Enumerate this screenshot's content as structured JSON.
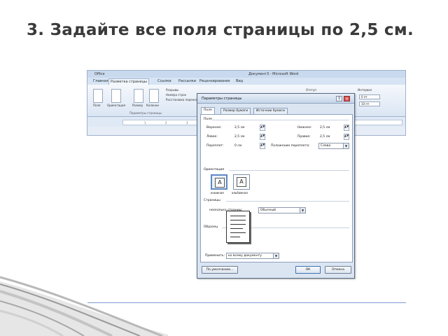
{
  "slide": {
    "title": "3. Задайте все поля страницы по 2,5 см."
  },
  "word": {
    "window_title": "Документ3 - Microsoft Word",
    "app_left_label": "Office",
    "tabs": [
      {
        "label": "Главная"
      },
      {
        "label": "Разметка страницы"
      },
      {
        "label": "Ссылки"
      },
      {
        "label": "Рассылки"
      },
      {
        "label": "Рецензирование"
      },
      {
        "label": "Вид"
      }
    ],
    "ribbon": {
      "buttons": [
        {
          "label": "Поля"
        },
        {
          "label": "Ориентация"
        },
        {
          "label": "Размер"
        },
        {
          "label": "Колонки"
        }
      ],
      "list_items": [
        "Разрывы",
        "Номера строк",
        "Расстановка переносов"
      ],
      "group_label": "Параметры страницы",
      "indent_label": "Отступ",
      "spacing_label": "Интервал",
      "spacing_fields": [
        "0 пт",
        "10 пт"
      ],
      "ruler_marks": [
        "1",
        "2",
        "3"
      ]
    }
  },
  "dialog": {
    "title": "Параметры страницы",
    "help_glyph": "?",
    "close_glyph": "×",
    "tabs": [
      {
        "label": "Поля"
      },
      {
        "label": "Размер бумаги"
      },
      {
        "label": "Источник бумаги"
      }
    ],
    "margins": {
      "section_label": "Поля",
      "top_label": "Верхнее:",
      "top_value": "2,5 см",
      "bottom_label": "Нижнее:",
      "bottom_value": "2,5 см",
      "left_label": "Левое:",
      "left_value": "2,5 см",
      "right_label": "Правое:",
      "right_value": "2,5 см",
      "gutter_label": "Переплет:",
      "gutter_value": "0 см",
      "gutter_pos_label": "Положение переплета:",
      "gutter_pos_value": "Слева"
    },
    "orientation": {
      "section_label": "Ориентация",
      "portrait_label": "книжная",
      "landscape_label": "альбомная",
      "glyph": "A"
    },
    "pages": {
      "section_label": "Страницы",
      "multiple_label": "несколько страниц:",
      "multiple_value": "Обычный"
    },
    "preview": {
      "section_label": "Образец"
    },
    "apply": {
      "label": "Применить:",
      "value": "ко всему документу"
    },
    "buttons": {
      "default_label": "По умолчанию...",
      "ok_label": "ОК",
      "cancel_label": "Отмена"
    },
    "spin_glyph": "▲▼",
    "arrow_glyph": "▼"
  }
}
